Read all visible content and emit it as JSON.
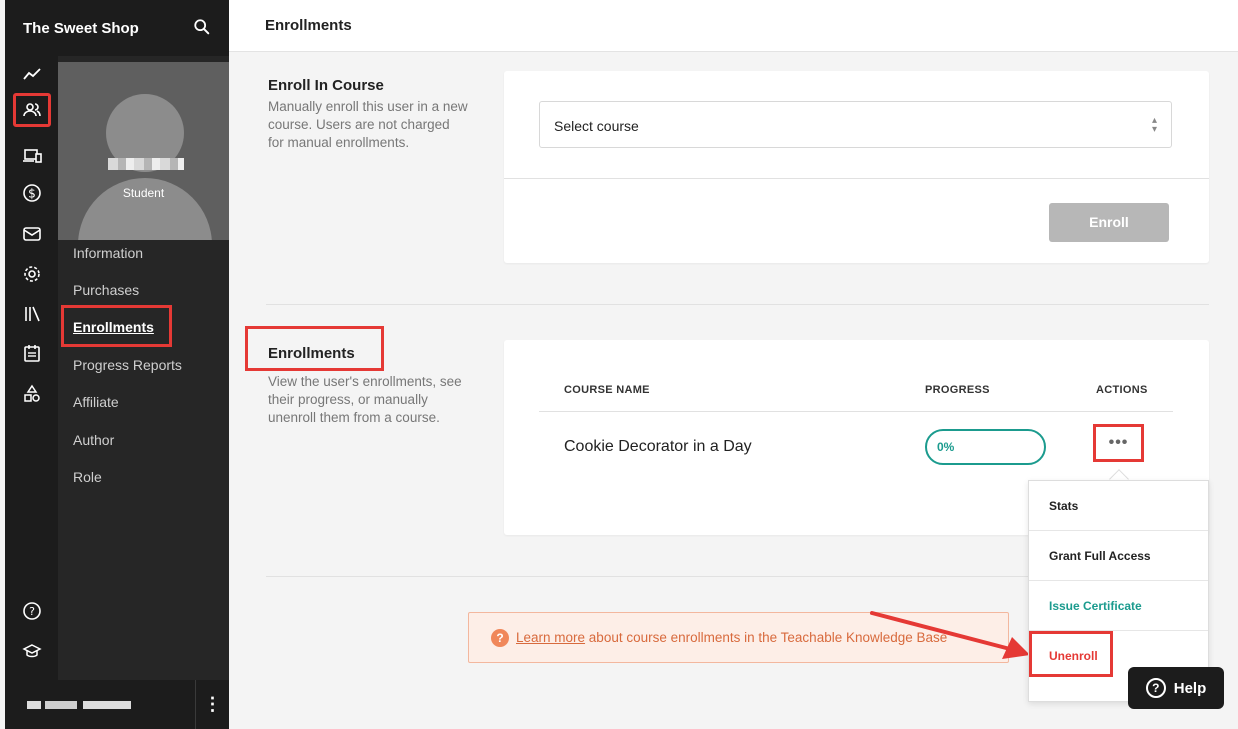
{
  "app": {
    "brand": "The Sweet Shop"
  },
  "rail": {
    "icons": [
      "analytics-icon",
      "users-icon",
      "courses-icon",
      "sales-icon",
      "email-icon",
      "settings-icon",
      "library-icon",
      "calendar-icon",
      "site-icon",
      "help-circle-icon",
      "graduation-icon"
    ],
    "active": "users-icon"
  },
  "user_panel": {
    "role": "Student",
    "nav": [
      "Information",
      "Purchases",
      "Enrollments",
      "Progress Reports",
      "Affiliate",
      "Author",
      "Role"
    ],
    "active": "Enrollments"
  },
  "header": {
    "title": "Enrollments"
  },
  "enroll_section": {
    "title": "Enroll In Course",
    "description_lines": [
      "Manually enroll this user in a new",
      "course. Users are not charged",
      "for manual enrollments."
    ],
    "select_placeholder": "Select course",
    "enroll_button": "Enroll"
  },
  "enrollments_section": {
    "title": "Enrollments",
    "description_lines": [
      "View the user's enrollments, see",
      "their progress, or manually",
      "unenroll them from a course."
    ],
    "columns": [
      "COURSE NAME",
      "PROGRESS",
      "ACTIONS"
    ],
    "rows": [
      {
        "course": "Cookie Decorator in a Day",
        "progress": "0%"
      }
    ],
    "actions_button": "•••",
    "menu": [
      "Stats",
      "Grant Full Access",
      "Issue Certificate",
      "Unenroll"
    ]
  },
  "info_banner": {
    "icon": "?",
    "link": "Learn more",
    "text": " about course enrollments in the Teachable Knowledge Base"
  },
  "help_button": {
    "label": "Help",
    "icon": "?"
  },
  "colors": {
    "accent": "#1b9b8e",
    "annotation_red": "#e53935",
    "sidebar": "#1c1c1c",
    "info_text": "#d86a3d"
  }
}
